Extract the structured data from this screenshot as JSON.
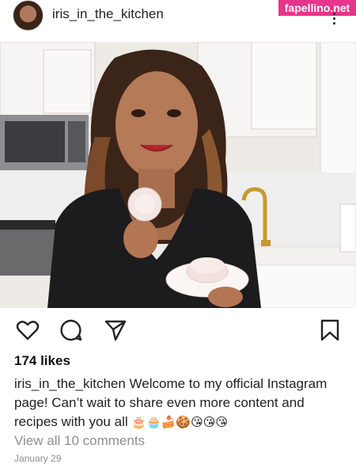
{
  "post": {
    "username": "iris_in_the_kitchen",
    "likes": "174 likes",
    "caption_author": "iris_in_the_kitchen",
    "caption_text": "Welcome to my official Instagram page! Can’t wait to share even more content and recipes with you all",
    "caption_emojis": "🎂🧁🍰🍪😘😘😘",
    "comments_link": "View all 10 comments",
    "date": "January 29"
  },
  "watermark": "fapellino.net",
  "icons": {
    "like": "heart-icon",
    "comment": "comment-bubble-icon",
    "share": "paper-plane-icon",
    "save": "bookmark-icon",
    "more": "more-vertical-icon"
  },
  "colors": {
    "watermark_bg": "#e8348a",
    "muted_text": "#8e8e8e"
  }
}
